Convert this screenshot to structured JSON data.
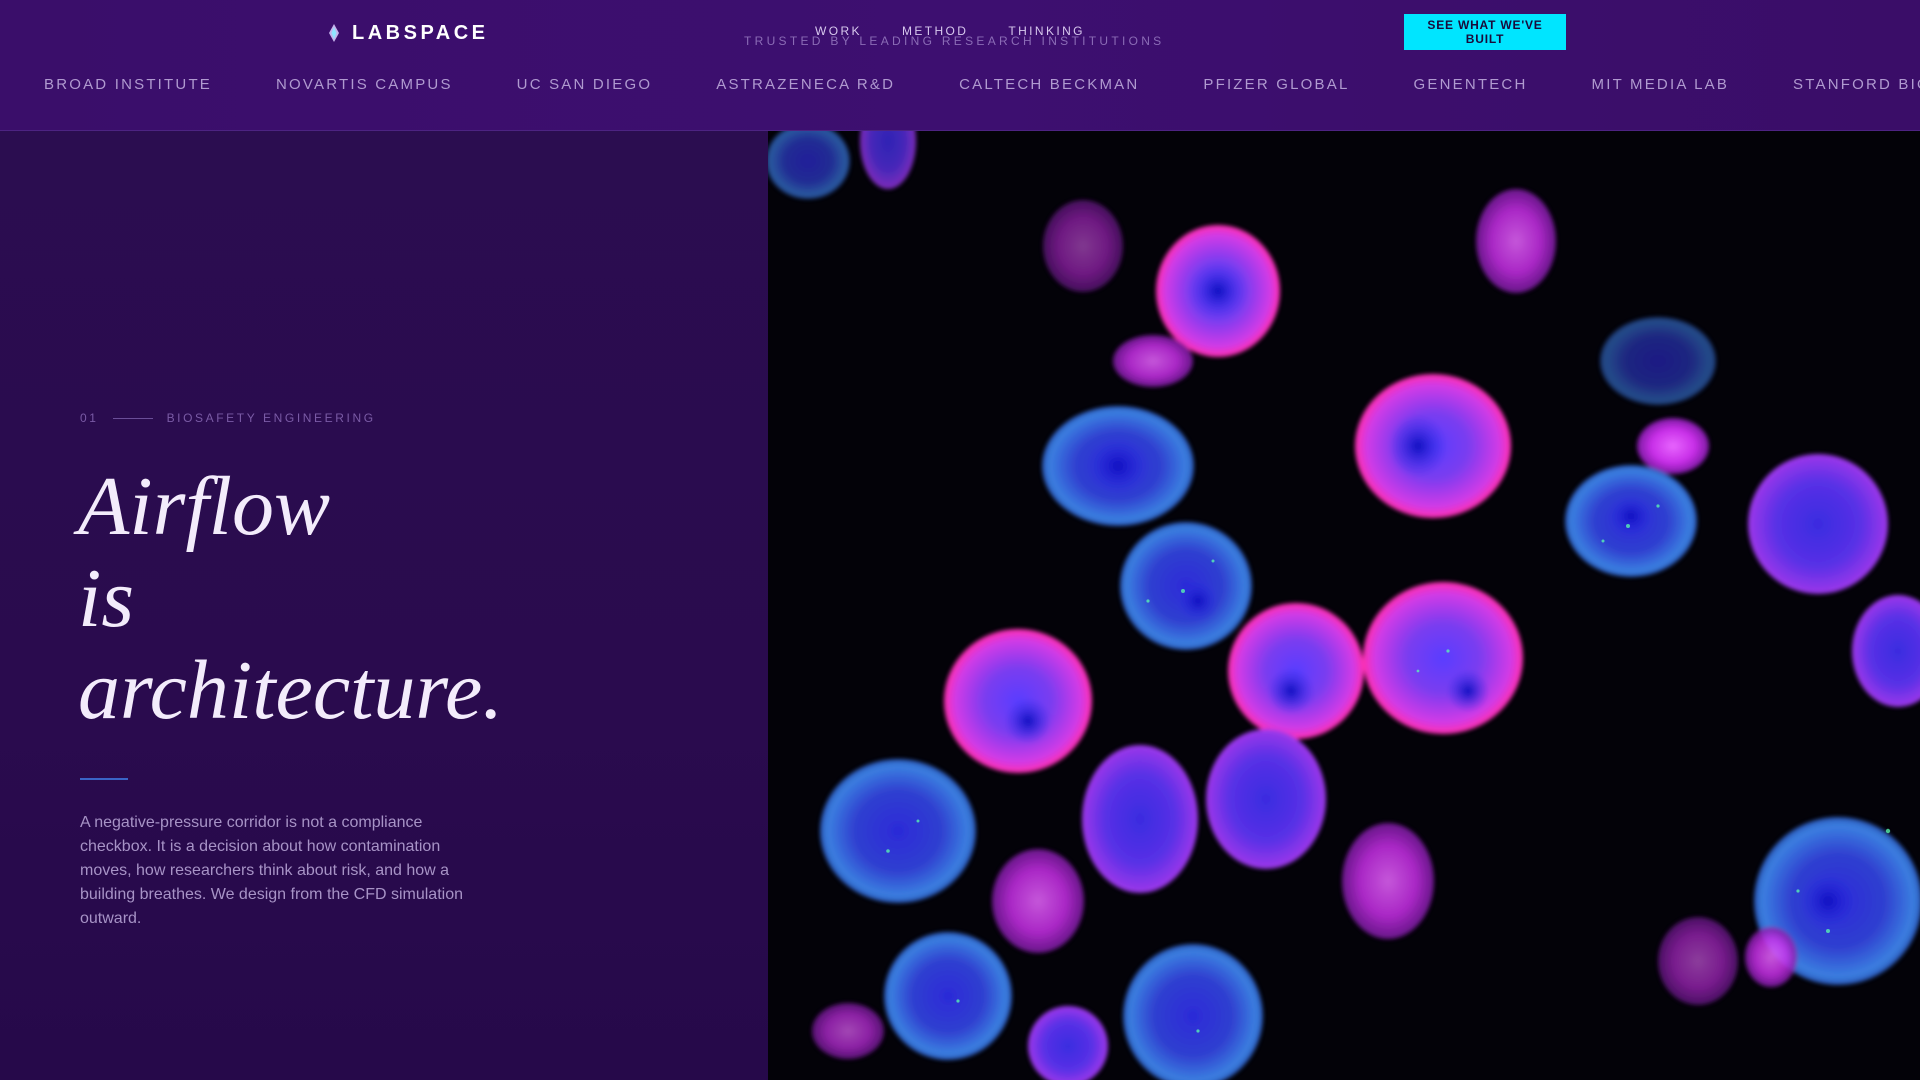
{
  "header": {
    "logo_text": "LABSPACE",
    "nav": [
      "WORK",
      "METHOD",
      "THINKING"
    ],
    "trusted_label": "TRUSTED BY LEADING RESEARCH INSTITUTIONS",
    "cta_label": "SEE WHAT WE'VE BUILT",
    "institutions": [
      "BROAD INSTITUTE",
      "NOVARTIS CAMPUS",
      "UC SAN DIEGO",
      "ASTRAZENECA R&D",
      "CALTECH BECKMAN",
      "PFIZER GLOBAL",
      "GENENTECH",
      "MIT MEDIA LAB",
      "STANFORD BIOPHARMA"
    ]
  },
  "hero": {
    "eyebrow_number": "01",
    "eyebrow_label": "BIOSAFETY ENGINEERING",
    "headline": [
      "Airflow",
      "is",
      "architecture."
    ],
    "body": "A negative-pressure corridor is not a compliance checkbox. It is a decision about how contamination moves, how researchers think about risk, and how a building breathes. We design from the CFD simulation outward."
  },
  "colors": {
    "header_bg": "#3c0f6e",
    "panel_bg": "#2a0b4e",
    "cta_bg": "#00e5ff",
    "accent_rule": "#3a64c6"
  }
}
